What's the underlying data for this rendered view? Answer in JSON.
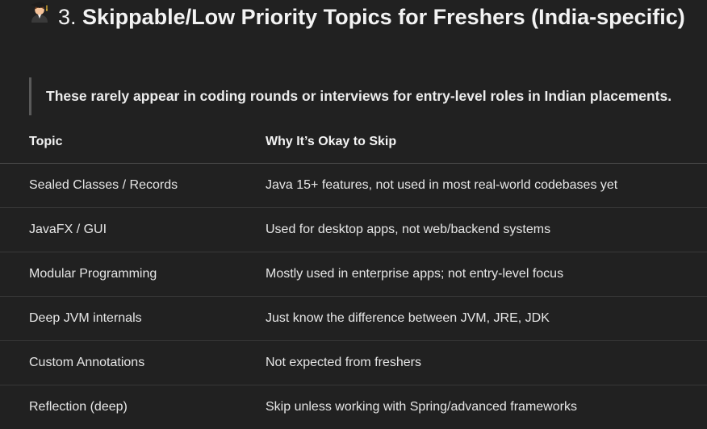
{
  "section": {
    "emoji_icon": "student-emoji-icon",
    "number": "3.",
    "title": "Skippable/Low Priority Topics for Freshers (India-specific)"
  },
  "note": "These rarely appear in coding rounds or interviews for entry-level roles in Indian placements.",
  "table": {
    "headers": [
      "Topic",
      "Why It’s Okay to Skip"
    ],
    "rows": [
      [
        "Sealed Classes / Records",
        "Java 15+ features, not used in most real-world codebases yet"
      ],
      [
        "JavaFX / GUI",
        "Used for desktop apps, not web/backend systems"
      ],
      [
        "Modular Programming",
        "Mostly used in enterprise apps; not entry-level focus"
      ],
      [
        "Deep JVM internals",
        "Just know the difference between JVM, JRE, JDK"
      ],
      [
        "Custom Annotations",
        "Not expected from freshers"
      ],
      [
        "Reflection (deep)",
        "Skip unless working with Spring/advanced frameworks"
      ]
    ]
  }
}
